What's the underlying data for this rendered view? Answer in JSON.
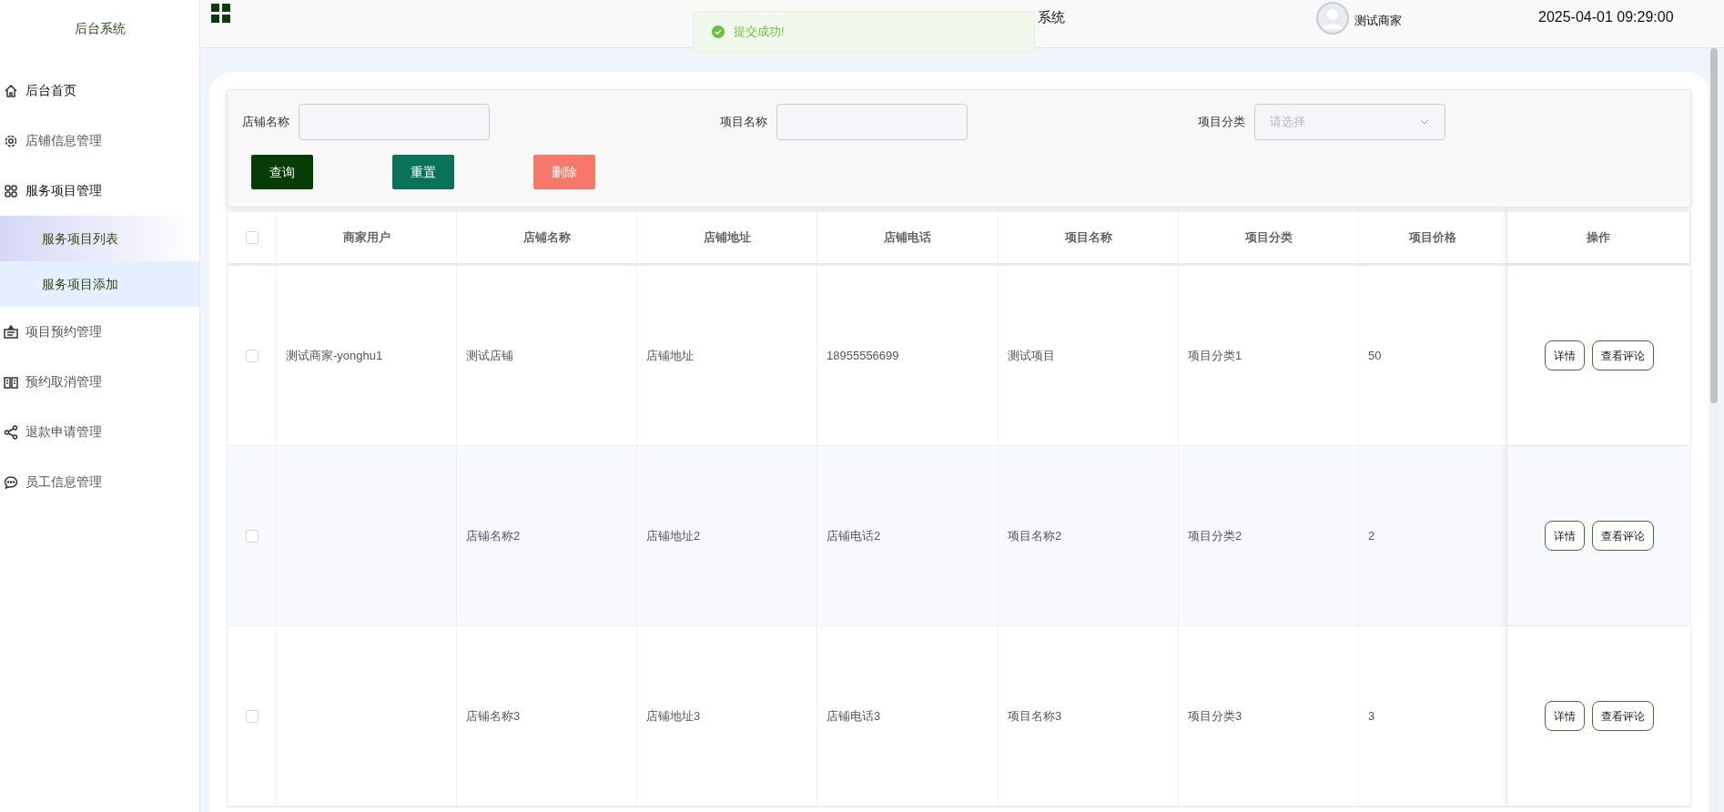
{
  "sidebar": {
    "title": "后台系统",
    "items": [
      {
        "label": "后台首页"
      },
      {
        "label": "店铺信息管理"
      },
      {
        "label": "服务项目管理",
        "children": [
          {
            "label": "服务项目列表",
            "selected": true,
            "hovered": false
          },
          {
            "label": "服务项目添加",
            "selected": false,
            "hovered": true
          }
        ]
      },
      {
        "label": "项目预约管理"
      },
      {
        "label": "预约取消管理"
      },
      {
        "label": "退款申请管理"
      },
      {
        "label": "员工信息管理"
      }
    ]
  },
  "header": {
    "title": "系统",
    "user": "测试商家",
    "datetime": "2025-04-01 09:29:00"
  },
  "toast": {
    "message": "提交成功!",
    "kind": "success"
  },
  "search": {
    "fields": [
      {
        "label": "店铺名称",
        "kind": "input"
      },
      {
        "label": "项目名称",
        "kind": "input"
      },
      {
        "label": "项目分类",
        "kind": "select",
        "placeholder": "请选择"
      }
    ],
    "buttons": [
      {
        "label": "查询",
        "kind": "primary"
      },
      {
        "label": "重置",
        "kind": "secondary"
      },
      {
        "label": "删除",
        "kind": "danger"
      }
    ]
  },
  "table": {
    "all_checked": false,
    "columns": [
      "商家用户",
      "店铺名称",
      "店铺地址",
      "店铺电话",
      "项目名称",
      "项目分类",
      "项目价格",
      "操作"
    ],
    "rows": [
      {
        "checked": false,
        "cells": [
          "测试商家-yonghu1",
          "测试店铺",
          "店铺地址",
          "18955556699",
          "测试项目",
          "项目分类1",
          "50"
        ],
        "actions": [
          "详情",
          "查看评论"
        ]
      },
      {
        "checked": false,
        "cells": [
          "",
          "店铺名称2",
          "店铺地址2",
          "店铺电话2",
          "项目名称2",
          "项目分类2",
          "2"
        ],
        "actions": [
          "详情",
          "查看评论"
        ]
      },
      {
        "checked": false,
        "cells": [
          "",
          "店铺名称3",
          "店铺地址3",
          "店铺电话3",
          "项目名称3",
          "项目分类3",
          "3"
        ],
        "actions": [
          "详情",
          "查看评论"
        ]
      }
    ]
  }
}
